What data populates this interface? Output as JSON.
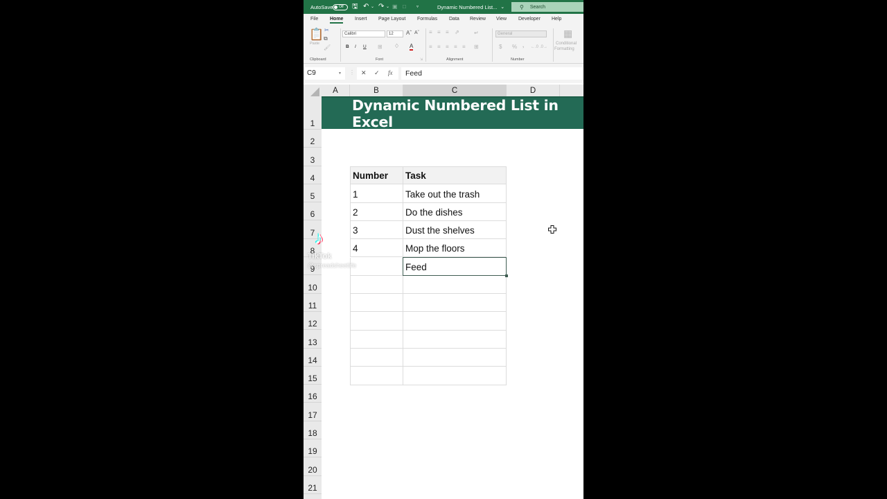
{
  "titlebar": {
    "autosave_label": "AutoSave",
    "autosave_state": "Off",
    "document_title": "Dynamic Numbered List...",
    "search_placeholder": "Search"
  },
  "ribbon_tabs": [
    "File",
    "Home",
    "Insert",
    "Page Layout",
    "Formulas",
    "Data",
    "Review",
    "View",
    "Developer",
    "Help"
  ],
  "ribbon_active_tab": "Home",
  "ribbon": {
    "clipboard": {
      "paste_label": "Paste",
      "group_label": "Clipboard"
    },
    "font": {
      "font_name": "Calibri",
      "font_size": "12",
      "bold": "B",
      "italic": "I",
      "underline": "U",
      "group_label": "Font"
    },
    "alignment": {
      "group_label": "Alignment"
    },
    "number": {
      "format": "General",
      "currency": "$",
      "percent": "%",
      "comma": ",",
      "group_label": "Number"
    },
    "styles": {
      "conditional_line1": "Conditional",
      "conditional_line2": "Formatting"
    }
  },
  "formula_bar": {
    "name_box": "C9",
    "cancel_icon": "✕",
    "enter_icon": "✓",
    "fx_label": "fx",
    "content": "Feed"
  },
  "columns": [
    "A",
    "B",
    "C",
    "D"
  ],
  "selected_column": "C",
  "rows": [
    "1",
    "2",
    "3",
    "4",
    "5",
    "6",
    "7",
    "8",
    "9",
    "10",
    "11",
    "12",
    "13",
    "14",
    "15",
    "16",
    "17",
    "18",
    "19",
    "20",
    "21"
  ],
  "banner_title": "Dynamic Numbered List in Excel",
  "table": {
    "headers": [
      "Number",
      "Task"
    ],
    "rows": [
      [
        "1",
        "Take out the trash"
      ],
      [
        "2",
        "Do the dishes"
      ],
      [
        "3",
        "Dust the shelves"
      ],
      [
        "4",
        "Mop the floors"
      ],
      [
        "",
        "Feed"
      ],
      [
        "",
        ""
      ],
      [
        "",
        ""
      ],
      [
        "",
        ""
      ],
      [
        "",
        ""
      ],
      [
        "",
        ""
      ],
      [
        "",
        ""
      ]
    ]
  },
  "active_cell": "C9",
  "watermark": {
    "brand": "TikTok",
    "handle": "@spreadsheetlife"
  },
  "colors": {
    "excel_green": "#217346",
    "banner_green": "#236a55"
  }
}
